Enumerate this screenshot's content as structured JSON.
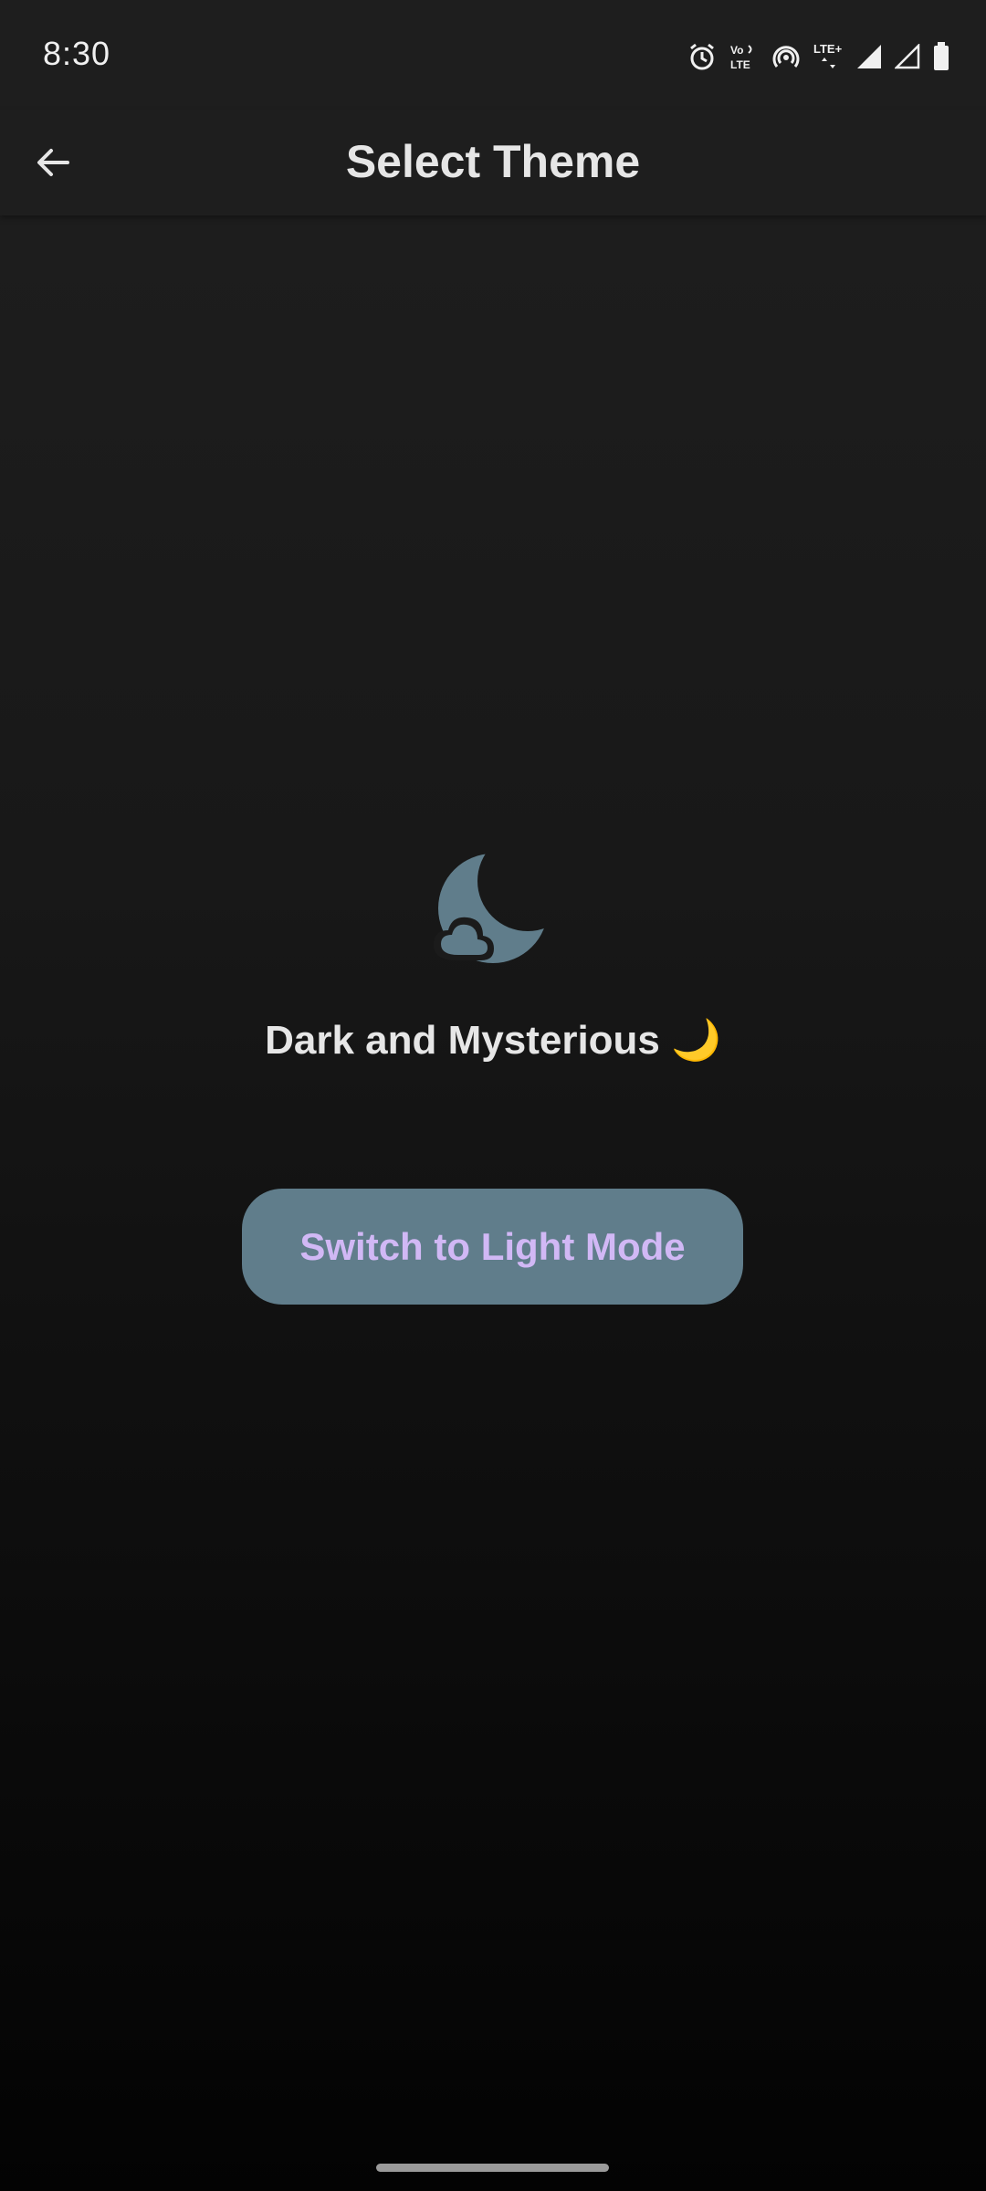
{
  "status_bar": {
    "time": "8:30",
    "icons": [
      "alarm-icon",
      "volte-icon",
      "hotspot-icon",
      "lte-plus-icon",
      "signal-full-icon",
      "signal-outline-icon",
      "battery-icon"
    ]
  },
  "app_bar": {
    "title": "Select Theme",
    "back_icon": "arrow-back-icon"
  },
  "theme": {
    "icon": "moon-cloud-icon",
    "label": "Dark and Mysterious 🌙",
    "button_label": "Switch to Light Mode"
  },
  "colors": {
    "button_bg": "#607d8b",
    "button_text": "#d1b8f5",
    "icon_color": "#607d8b"
  }
}
